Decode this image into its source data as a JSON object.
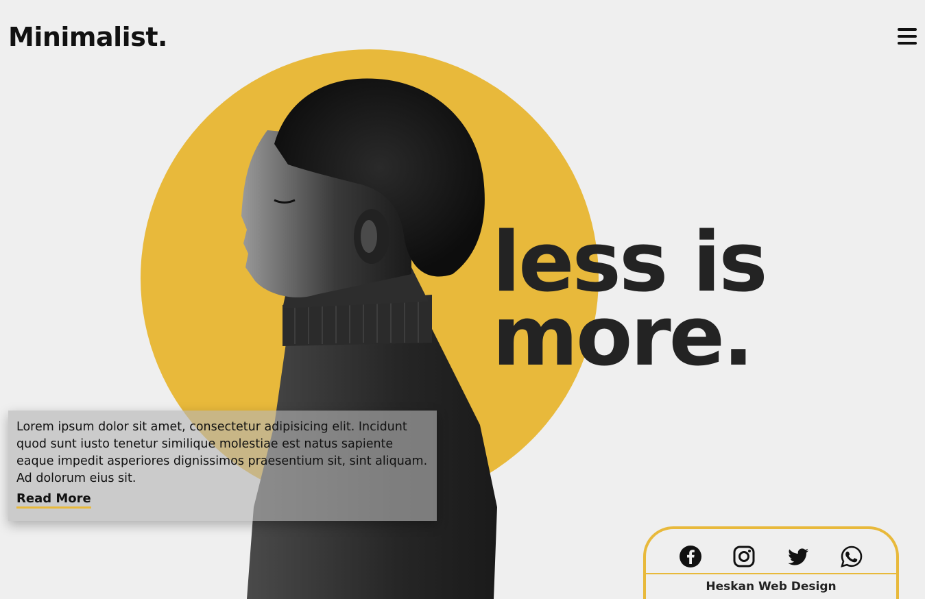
{
  "header": {
    "logo": "Minimalist.",
    "menu_icon": "hamburger-menu-icon"
  },
  "hero": {
    "headline_line1": "less is",
    "headline_line2": "more.",
    "accent_color": "#e8b93b",
    "headline_color": "#232323",
    "background_color": "#efefef"
  },
  "intro": {
    "body": "Lorem ipsum dolor sit amet, consectetur adipisicing elit. Incidunt quod sunt iusto tenetur similique molestiae est natus sapiente eaque impedit asperiores dignissimos praesentium sit, sint aliquam. Ad dolorum eius sit.",
    "read_more_label": "Read More"
  },
  "social": {
    "icons": [
      "facebook-icon",
      "instagram-icon",
      "twitter-icon",
      "whatsapp-icon"
    ],
    "credit": "Heskan Web Design"
  }
}
